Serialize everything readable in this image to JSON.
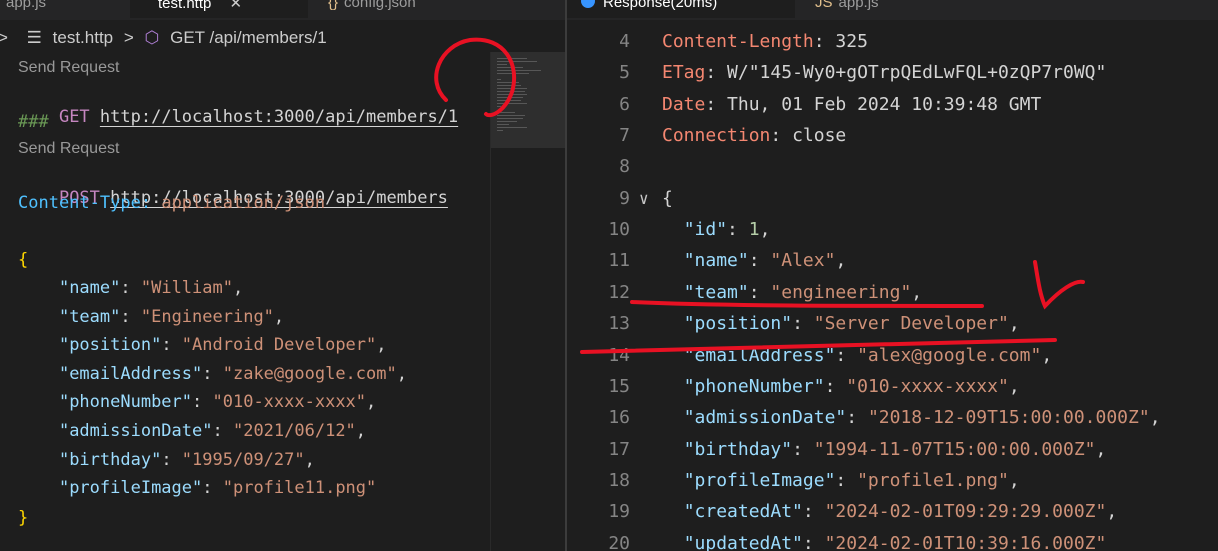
{
  "left": {
    "tabs": [
      {
        "label": "app.js",
        "icon": "js-file-icon"
      },
      {
        "label": "test.http",
        "icon": "menu-lines-icon"
      },
      {
        "label": "config.json",
        "icon": "json-braces-icon"
      }
    ],
    "breadcrumb": {
      "file": "test.http",
      "symbol": "GET /api/members/1"
    },
    "codelens_1": "Send Request",
    "request_1": {
      "method": "GET",
      "url": "http://localhost:3000/api/members/1"
    },
    "separator": "###",
    "codelens_2": "Send Request",
    "request_2": {
      "method": "POST",
      "url": "http://localhost:3000/api/members"
    },
    "header": {
      "name": "Content-Type",
      "colon": ":",
      "value": "application/json"
    },
    "body_open": "{",
    "body_close": "}",
    "body": [
      {
        "key": "\"name\"",
        "value": "\"William\"",
        "comma": ","
      },
      {
        "key": "\"team\"",
        "value": "\"Engineering\"",
        "comma": ","
      },
      {
        "key": "\"position\"",
        "value": "\"Android Developer\"",
        "comma": ","
      },
      {
        "key": "\"emailAddress\"",
        "value": "\"zake@google.com\"",
        "comma": ","
      },
      {
        "key": "\"phoneNumber\"",
        "value": "\"010-xxxx-xxxx\"",
        "comma": ","
      },
      {
        "key": "\"admissionDate\"",
        "value": "\"2021/06/12\"",
        "comma": ","
      },
      {
        "key": "\"birthday\"",
        "value": "\"1995/09/27\"",
        "comma": ","
      },
      {
        "key": "\"profileImage\"",
        "value": "\"profile11.png\"",
        "comma": ""
      }
    ]
  },
  "right": {
    "tabs": [
      {
        "label": "Response(20ms)",
        "icon": "response-dot-icon"
      },
      {
        "label": "app.js",
        "icon": "js-file-icon"
      }
    ],
    "header_lines": [
      {
        "ln": "4",
        "name": "Content-Length",
        "value": "325"
      },
      {
        "ln": "5",
        "name": "ETag",
        "value": "W/\"145-Wy0+gOTrpQEdLwFQL+0zQP7r0WQ\""
      },
      {
        "ln": "6",
        "name": "Date",
        "value": "Thu, 01 Feb 2024 10:39:48 GMT"
      },
      {
        "ln": "7",
        "name": "Connection",
        "value": "close"
      }
    ],
    "blank_ln": "8",
    "open_ln": "9",
    "open_brace": "{",
    "json_lines": [
      {
        "ln": "10",
        "key": "\"id\"",
        "value": "1",
        "type": "num",
        "comma": ","
      },
      {
        "ln": "11",
        "key": "\"name\"",
        "value": "\"Alex\"",
        "type": "str",
        "comma": ","
      },
      {
        "ln": "12",
        "key": "\"team\"",
        "value": "\"engineering\"",
        "type": "str",
        "comma": ","
      },
      {
        "ln": "13",
        "key": "\"position\"",
        "value": "\"Server Developer\"",
        "type": "str",
        "comma": ","
      },
      {
        "ln": "14",
        "key": "\"emailAddress\"",
        "value": "\"alex@google.com\"",
        "type": "str",
        "comma": ","
      },
      {
        "ln": "15",
        "key": "\"phoneNumber\"",
        "value": "\"010-xxxx-xxxx\"",
        "type": "str",
        "comma": ","
      },
      {
        "ln": "16",
        "key": "\"admissionDate\"",
        "value": "\"2018-12-09T15:00:00.000Z\"",
        "type": "str",
        "comma": ","
      },
      {
        "ln": "17",
        "key": "\"birthday\"",
        "value": "\"1994-11-07T15:00:00.000Z\"",
        "type": "str",
        "comma": ","
      },
      {
        "ln": "18",
        "key": "\"profileImage\"",
        "value": "\"profile1.png\"",
        "type": "str",
        "comma": ","
      },
      {
        "ln": "19",
        "key": "\"createdAt\"",
        "value": "\"2024-02-01T09:29:29.000Z\"",
        "type": "str",
        "comma": ","
      },
      {
        "ln": "20",
        "key": "\"updatedAt\"",
        "value": "\"2024-02-01T10:39:16.000Z\"",
        "type": "str",
        "comma": ""
      }
    ]
  },
  "colors": {
    "annotation_red": "#e81123",
    "method": "#c586c0",
    "json_key": "#9cdcfe",
    "json_string": "#ce9178",
    "header_name": "#f48771"
  }
}
